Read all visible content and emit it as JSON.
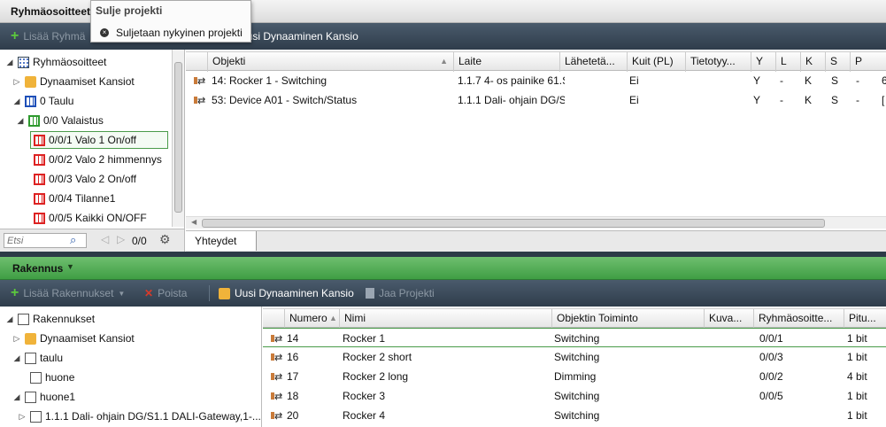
{
  "top": {
    "header_title": "Ryhmäosoitteet",
    "popup": {
      "title": "Sulje projekti",
      "item": "Suljetaan nykyinen projekti"
    },
    "toolbar": {
      "add_label": "Lisää Ryhmä",
      "new_dynamic_folder": "Uusi Dynaaminen Kansio"
    },
    "tree": [
      {
        "label": "Ryhmäosoitteet"
      },
      {
        "label": "Dynaamiset Kansiot"
      },
      {
        "label": "0 Taulu"
      },
      {
        "label": "0/0 Valaistus"
      },
      {
        "label": "0/0/1 Valo 1 On/off"
      },
      {
        "label": "0/0/2 Valo 2 himmennys"
      },
      {
        "label": "0/0/3 Valo 2 On/off"
      },
      {
        "label": "0/0/4 Tilanne1"
      },
      {
        "label": "0/0/5 Kaikki ON/OFF"
      }
    ],
    "search_placeholder": "Etsi",
    "counter": "0/0",
    "columns": [
      "Objekti",
      "Laite",
      "Lähetetä...",
      "Kuit (PL)",
      "Tietotyy...",
      "Y",
      "L",
      "K",
      "S",
      "P"
    ],
    "rows": [
      {
        "objekti": "14: Rocker 1 - Switching",
        "laite": "1.1.7 4- os painike 61.S",
        "kuit": "Ei",
        "y": "Y",
        "l": "-",
        "k": "K",
        "s": "S",
        "p": "-",
        "extra": "6"
      },
      {
        "objekti": "53: Device A01 - Switch/Status",
        "laite": "1.1.1 Dali- ohjain DG/S",
        "kuit": "Ei",
        "y": "Y",
        "l": "-",
        "k": "K",
        "s": "S",
        "p": "-",
        "extra": "["
      }
    ],
    "tab": "Yhteydet"
  },
  "bottom": {
    "header_title": "Rakennus",
    "toolbar": {
      "add_label": "Lisää Rakennukset",
      "delete_label": "Poista",
      "new_dynamic_folder": "Uusi Dynaaminen Kansio",
      "share_project": "Jaa Projekti"
    },
    "tree": [
      {
        "label": "Rakennukset"
      },
      {
        "label": "Dynaamiset Kansiot"
      },
      {
        "label": "taulu"
      },
      {
        "label": "huone"
      },
      {
        "label": "huone1"
      },
      {
        "label": "1.1.1 Dali- ohjain DG/S1.1 DALI-Gateway,1-..."
      }
    ],
    "columns": [
      "Numero",
      "Nimi",
      "Objektin Toiminto",
      "Kuva...",
      "Ryhmäosoitte...",
      "Pitu..."
    ],
    "rows": [
      {
        "numero": "14",
        "nimi": "Rocker 1",
        "toiminto": "Switching",
        "ryhma": "0/0/1",
        "pituus": "1 bit"
      },
      {
        "numero": "16",
        "nimi": "Rocker 2 short",
        "toiminto": "Switching",
        "ryhma": "0/0/3",
        "pituus": "1 bit"
      },
      {
        "numero": "17",
        "nimi": "Rocker 2 long",
        "toiminto": "Dimming",
        "ryhma": "0/0/2",
        "pituus": "4 bit"
      },
      {
        "numero": "18",
        "nimi": "Rocker 3",
        "toiminto": "Switching",
        "ryhma": "0/0/5",
        "pituus": "1 bit"
      },
      {
        "numero": "20",
        "nimi": "Rocker 4",
        "toiminto": "Switching",
        "ryhma": "",
        "pituus": "1 bit"
      }
    ]
  }
}
